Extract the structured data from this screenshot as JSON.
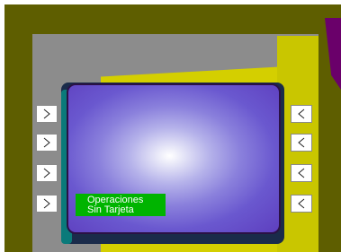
{
  "screen": {
    "option_label_line1": "Operaciones",
    "option_label_line2": "Sin Tarjeta"
  },
  "left_buttons": [
    {
      "icon": "chevron-right-icon",
      "glyph": ">"
    },
    {
      "icon": "chevron-right-icon",
      "glyph": ">"
    },
    {
      "icon": "chevron-right-icon",
      "glyph": ">"
    },
    {
      "icon": "chevron-right-icon",
      "glyph": ">"
    }
  ],
  "right_buttons": [
    {
      "icon": "chevron-left-icon",
      "glyph": "<"
    },
    {
      "icon": "chevron-left-icon",
      "glyph": "<"
    },
    {
      "icon": "chevron-left-icon",
      "glyph": "<"
    },
    {
      "icon": "chevron-left-icon",
      "glyph": "<"
    }
  ],
  "colors": {
    "option_label_bg": "#00b400",
    "screen_center": "#ffffff",
    "screen_edge": "#5e3fbf",
    "bezel_gray": "#8c8c8c",
    "bezel_yellow": "#d4cf00",
    "background_olive": "#5e5e00"
  }
}
